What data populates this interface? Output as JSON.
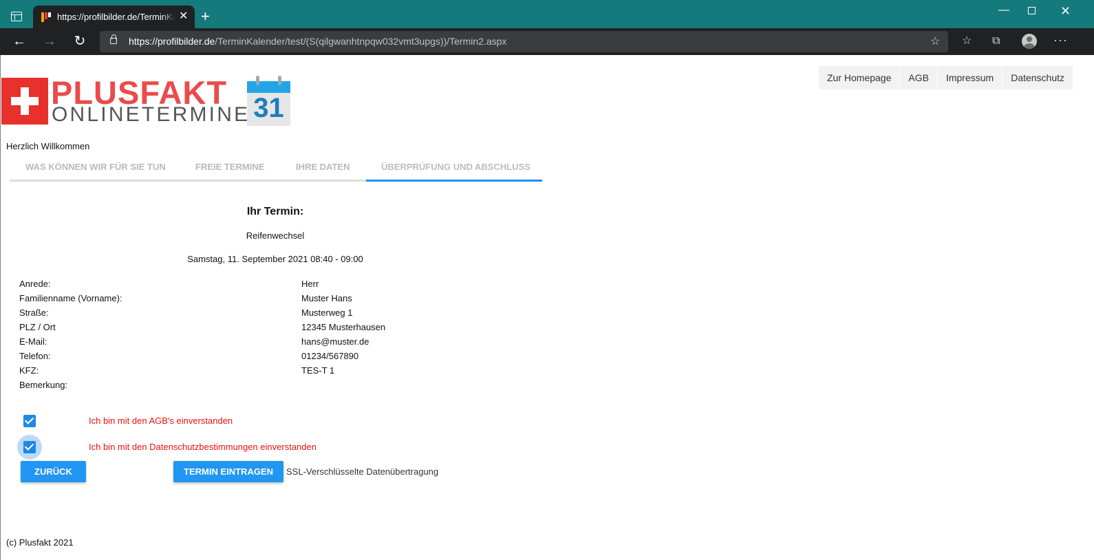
{
  "browser": {
    "tab_title": "https://profilbilder.de/TerminKalender/test/(S(qilgwanhtnpqw032vmt3upgs))/Termin2.aspx",
    "tab_close": "✕",
    "new_tab": "+",
    "url_host": "https://profilbilder.de",
    "url_path": "/TerminKalender/test/(S(qilgwanhtnpqw032vmt3upgs))/Termin2.aspx",
    "back": "←",
    "forward": "→",
    "reload": "↻",
    "minimize": "—",
    "close": "✕"
  },
  "logo": {
    "title": "PLUSFAKT",
    "subtitle": "ONLINETERMINE",
    "calendar_day": "31"
  },
  "topnav": [
    "Zur Homepage",
    "AGB",
    "Impressum",
    "Datenschutz"
  ],
  "welcome": "Herzlich Willkommen",
  "steps": [
    {
      "label": "Was können wir für Sie tun",
      "active": false
    },
    {
      "label": "Freie Termine",
      "active": false
    },
    {
      "label": "Ihre Daten",
      "active": false
    },
    {
      "label": "Überprüfung und Abschluss",
      "active": true
    }
  ],
  "appointment": {
    "heading": "Ihr Termin:",
    "service": "Reifenwechsel",
    "datetime": "Samstag, 11. September 2021 08:40 - 09:00"
  },
  "details": [
    {
      "label": "Anrede:",
      "value": "Herr"
    },
    {
      "label": "Familienname  (Vorname):",
      "value": "Muster  Hans"
    },
    {
      "label": "Straße:",
      "value": "Musterweg 1"
    },
    {
      "label": "PLZ / Ort",
      "value": "12345  Musterhausen"
    },
    {
      "label": "E-Mail:",
      "value": "hans@muster.de"
    },
    {
      "label": "Telefon:",
      "value": "01234/567890"
    },
    {
      "label": "KFZ:",
      "value": "TES-T 1"
    },
    {
      "label": "Bemerkung:",
      "value": ""
    }
  ],
  "consents": [
    {
      "label": "Ich bin mit den AGB's einverstanden",
      "checked": true
    },
    {
      "label": "Ich bin mit den Datenschutzbestimmungen einverstanden",
      "checked": true
    }
  ],
  "buttons": {
    "back": "Zurück",
    "submit": "Termin eintragen"
  },
  "ssl_note": "SSL-Verschlüsselte Datenübertragung",
  "footer": "(c) Plusfakt 2021",
  "colors": {
    "titlebar": "#157a7c",
    "accent": "#2196f3",
    "consent_text": "#e8110f",
    "logo_red": "#ea4b4b"
  }
}
